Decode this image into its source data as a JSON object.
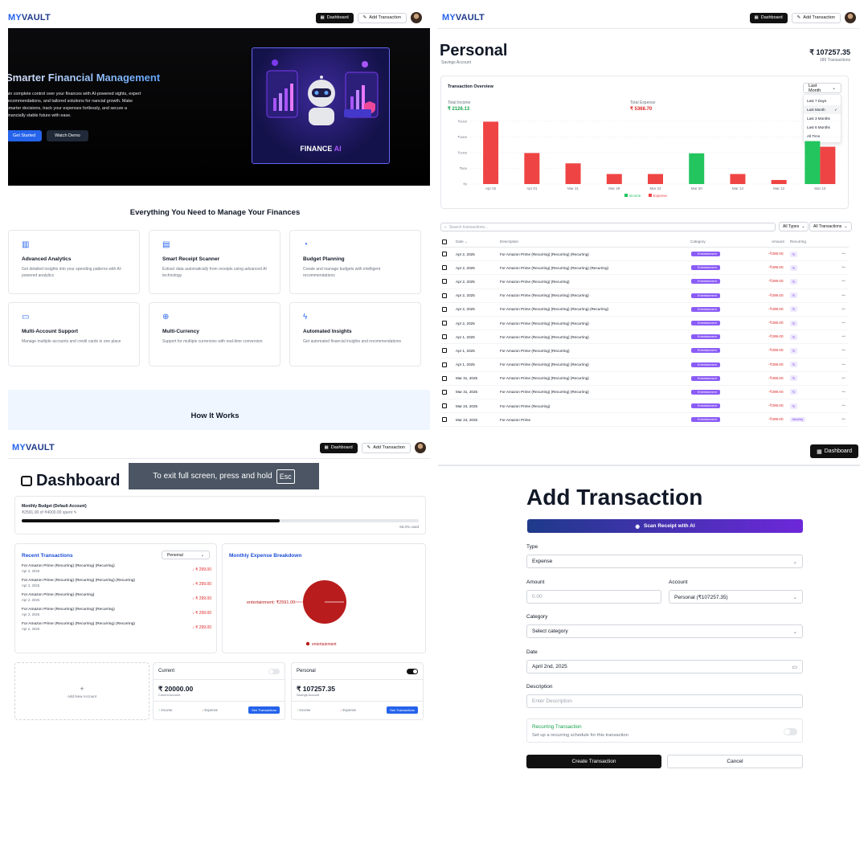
{
  "landing": {
    "brand_my": "MY",
    "brand_vault": "VAULT",
    "nav_dashboard": "Dashboard",
    "nav_add": "Add Transaction",
    "hero_title": "Smarter Financial Management",
    "hero_text": "ain complete control over your finances with AI-powered sights, expert recommendations, and tailored solutions for nancial growth. Make smarter decisions, track your expenses fortlessly, and secure a financially stable future with ease.",
    "get_started": "Get Started",
    "watch_demo": "Watch Demo",
    "hero_image_label_a": "FINANCE",
    "hero_image_label_b": "AI",
    "features_title": "Everything You Need to Manage Your Finances",
    "features": [
      {
        "title": "Advanced Analytics",
        "desc": "Get detailed insights into your spending patterns with AI-powered analytics",
        "icon": "bar-chart-icon"
      },
      {
        "title": "Smart Receipt Scanner",
        "desc": "Extract data automatically from receipts using advanced AI technology",
        "icon": "receipt-icon"
      },
      {
        "title": "Budget Planning",
        "desc": "Create and manage budgets with intelligent recommendations",
        "icon": "pie-chart-icon"
      },
      {
        "title": "Multi-Account Support",
        "desc": "Manage multiple accounts and credit cards in one place",
        "icon": "credit-card-icon"
      },
      {
        "title": "Multi-Currency",
        "desc": "Support for multiple currencies with real-time conversion",
        "icon": "globe-icon"
      },
      {
        "title": "Automated Insights",
        "desc": "Get automated financial insights and recommendations",
        "icon": "zap-icon"
      }
    ],
    "how_title": "How It Works"
  },
  "account": {
    "brand_my": "MY",
    "brand_vault": "VAULT",
    "nav_dashboard": "Dashboard",
    "nav_add": "Add Transaction",
    "name": "Personal",
    "type": "Savings Account",
    "balance": "₹ 107257.35",
    "tx_count": "185 Transactions",
    "overview_title": "Transaction Overview",
    "range_selected": "Last Month",
    "range_options": [
      "Last 7 Days",
      "Last Month",
      "Last 3 Months",
      "Last 6 Months",
      "All Time"
    ],
    "total_income_label": "Total Income",
    "total_income": "₹ 2126.13",
    "total_expense_label": "Total Expense",
    "total_expense": "₹ 5368.70",
    "search_placeholder": "Search transactions...",
    "filter_types": "All Types",
    "filter_tx": "All Transactions",
    "cols": {
      "date": "Date",
      "desc": "Description",
      "category": "Category",
      "amount": "Amount",
      "recurring": "Recurring"
    },
    "category_label": "Entertainment",
    "rows": [
      {
        "date": "Apr 2, 2025",
        "desc": "For Amazon Prime (Recurring) (Recurring) (Recurring)",
        "amount": "-₹299.00",
        "rec": ""
      },
      {
        "date": "Apr 2, 2025",
        "desc": "For Amazon Prime (Recurring) (Recurring) (Recurring) (Recurring)",
        "amount": "-₹299.00",
        "rec": ""
      },
      {
        "date": "Apr 2, 2025",
        "desc": "For Amazon Prime (Recurring) (Recurring)",
        "amount": "-₹299.00",
        "rec": ""
      },
      {
        "date": "Apr 2, 2025",
        "desc": "For Amazon Prime (Recurring) (Recurring) (Recurring)",
        "amount": "-₹299.00",
        "rec": ""
      },
      {
        "date": "Apr 2, 2025",
        "desc": "For Amazon Prime (Recurring) (Recurring) (Recurring) (Recurring)",
        "amount": "-₹299.00",
        "rec": ""
      },
      {
        "date": "Apr 2, 2025",
        "desc": "For Amazon Prime (Recurring) (Recurring) (Recurring)",
        "amount": "-₹299.00",
        "rec": ""
      },
      {
        "date": "Apr 1, 2025",
        "desc": "For Amazon Prime (Recurring) (Recurring) (Recurring)",
        "amount": "-₹299.00",
        "rec": ""
      },
      {
        "date": "Apr 1, 2025",
        "desc": "For Amazon Prime (Recurring) (Recurring)",
        "amount": "-₹299.00",
        "rec": ""
      },
      {
        "date": "Apr 1, 2025",
        "desc": "For Amazon Prime (Recurring) (Recurring) (Recurring)",
        "amount": "-₹299.00",
        "rec": ""
      },
      {
        "date": "Mar 31, 2025",
        "desc": "For Amazon Prime (Recurring) (Recurring) (Recurring)",
        "amount": "-₹299.00",
        "rec": ""
      },
      {
        "date": "Mar 31, 2025",
        "desc": "For Amazon Prime (Recurring) (Recurring) (Recurring)",
        "amount": "-₹299.00",
        "rec": ""
      },
      {
        "date": "Mar 24, 2025",
        "desc": "For Amazon Prime (Recurring)",
        "amount": "-₹299.00",
        "rec": ""
      },
      {
        "date": "Mar 24, 2025",
        "desc": "For Amazon Prime",
        "amount": "-₹299.00",
        "rec": "Monthly"
      }
    ]
  },
  "chart_data": {
    "type": "bar",
    "categories": [
      "Apr 02",
      "Apr 01",
      "Mar 31",
      "Mar 29",
      "Mar 24",
      "Mar 20",
      "Mar 13",
      "Mar 12",
      "Mar 10"
    ],
    "series": [
      {
        "name": "Income",
        "color": "#22c55e",
        "values": [
          0,
          0,
          0,
          0,
          0,
          980,
          0,
          0,
          1370
        ]
      },
      {
        "name": "Expense",
        "color": "#ef4444",
        "values": [
          1990,
          990,
          660,
          320,
          320,
          0,
          320,
          130,
          1190
        ]
      }
    ],
    "yticks": [
      "₹2000",
      "₹1500",
      "₹1000",
      "₹500",
      "₹0"
    ],
    "ylim": [
      0,
      2000
    ],
    "grid": true,
    "legend": "bottom"
  },
  "dashboard": {
    "brand_my": "MY",
    "brand_vault": "VAULT",
    "nav_dashboard": "Dashboard",
    "nav_add": "Add Transaction",
    "title": "Dashboard",
    "fullscreen_toast": "To exit full screen, press and hold",
    "esc_key": "Esc",
    "budget_title": "Monthly Budget (Default Account)",
    "budget_spent": "₹2591.00 of ₹4000.00 spent",
    "budget_fraction": 0.65,
    "budget_used": "65.0% used",
    "recent_title": "Recent Transactions",
    "recent_account": "Personal",
    "recent": [
      {
        "desc": "For Amazon Prime (Recurring) (Recurring) (Recurring)",
        "date": "Apr 2, 2025",
        "amount": "↓ ₹ 299.00"
      },
      {
        "desc": "For Amazon Prime (Recurring) (Recurring) (Recurring) (Recurring)",
        "date": "Apr 2, 2025",
        "amount": "↓ ₹ 299.00"
      },
      {
        "desc": "For Amazon Prime (Recurring) (Recurring)",
        "date": "Apr 2, 2025",
        "amount": "↓ ₹ 299.00"
      },
      {
        "desc": "For Amazon Prime (Recurring) (Recurring) (Recurring)",
        "date": "Apr 2, 2025",
        "amount": "↓ ₹ 299.00"
      },
      {
        "desc": "For Amazon Prime (Recurring) (Recurring) (Recurring) (Recurring)",
        "date": "Apr 2, 2025",
        "amount": "↓ ₹ 299.00"
      }
    ],
    "breakdown_title": "Monthly Expense Breakdown",
    "pie_label": "entertainment: ₹2591.00",
    "pie_legend": "entertainment",
    "pie_color": "#b91c1c",
    "add_account": "Add New Account",
    "accounts": [
      {
        "name": "Current",
        "balance": "₹ 20000.00",
        "type": "Current Account",
        "income": "Income",
        "expense": "Expense",
        "see": "See Transactions",
        "is_default": false
      },
      {
        "name": "Personal",
        "balance": "₹ 107257.35",
        "type": "Savings Account",
        "income": "Income",
        "expense": "Expense",
        "see": "See Transactions",
        "is_default": true
      }
    ]
  },
  "add_tx": {
    "nav_dashboard": "Dashboard",
    "title": "Add Transaction",
    "scan": "Scan Receipt with AI",
    "type_label": "Type",
    "type_value": "Expense",
    "amount_label": "Amount",
    "amount_placeholder": "0.00",
    "account_label": "Account",
    "account_value": "Personal (₹107257.35)",
    "category_label": "Category",
    "category_placeholder": "Select category",
    "date_label": "Date",
    "date_value": "April 2nd, 2025",
    "description_label": "Description",
    "description_placeholder": "Enter Description",
    "recurring_title": "Recurring Transaction",
    "recurring_desc": "Set up a recurring schedule for this transaction",
    "create": "Create Transaction",
    "cancel": "Cancel"
  }
}
